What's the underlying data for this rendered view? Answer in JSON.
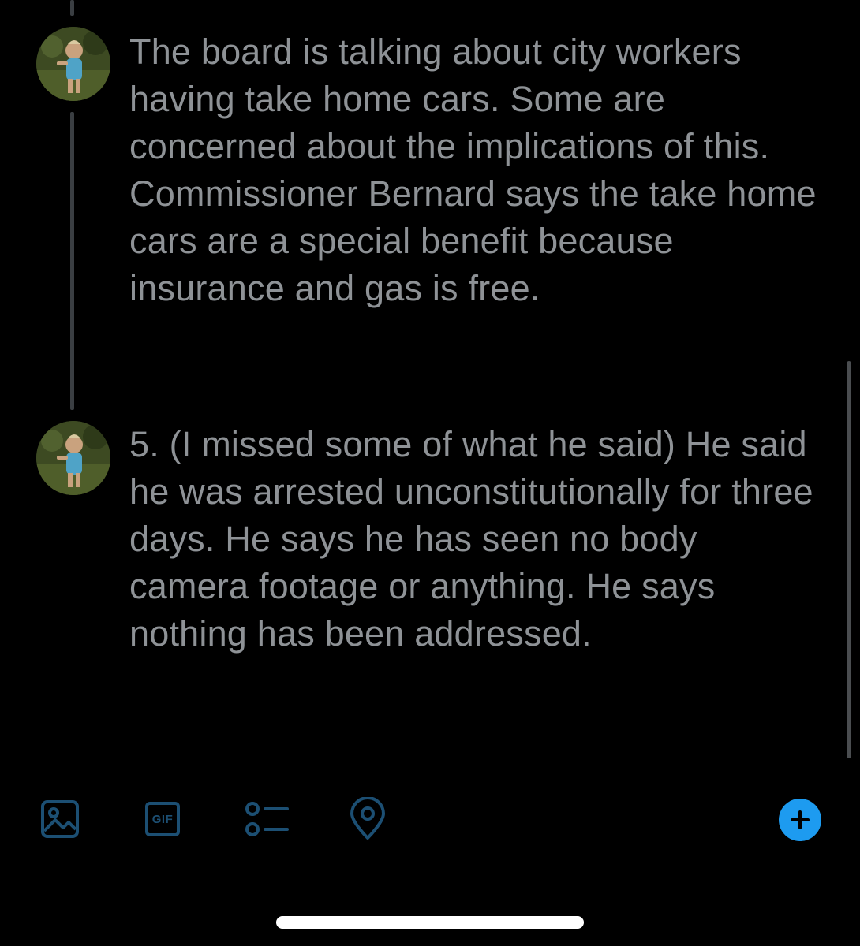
{
  "thread": {
    "tweets": [
      {
        "text": "The board is talking about city workers having take home cars. Some are concerned about the implications of this. Commissioner Bernard says the take home cars are a special benefit because insurance and gas is free.",
        "avatar_icon": "child-photo-avatar"
      },
      {
        "text": "5. (I missed some of what he said) He said he was arrested unconstitutionally for three days. He says he has seen no body camera footage or anything. He says nothing has been addressed.",
        "avatar_icon": "child-photo-avatar"
      }
    ]
  },
  "toolbar": {
    "icons": [
      "image-icon",
      "gif-icon",
      "poll-icon",
      "location-icon",
      "add-tweet-icon"
    ],
    "gif_label": "GIF"
  },
  "colors": {
    "background": "#000000",
    "text": "#8e9296",
    "toolbar_icon": "#1c4f73",
    "accent": "#1d9bf0",
    "thread_line": "#3a3e42"
  }
}
